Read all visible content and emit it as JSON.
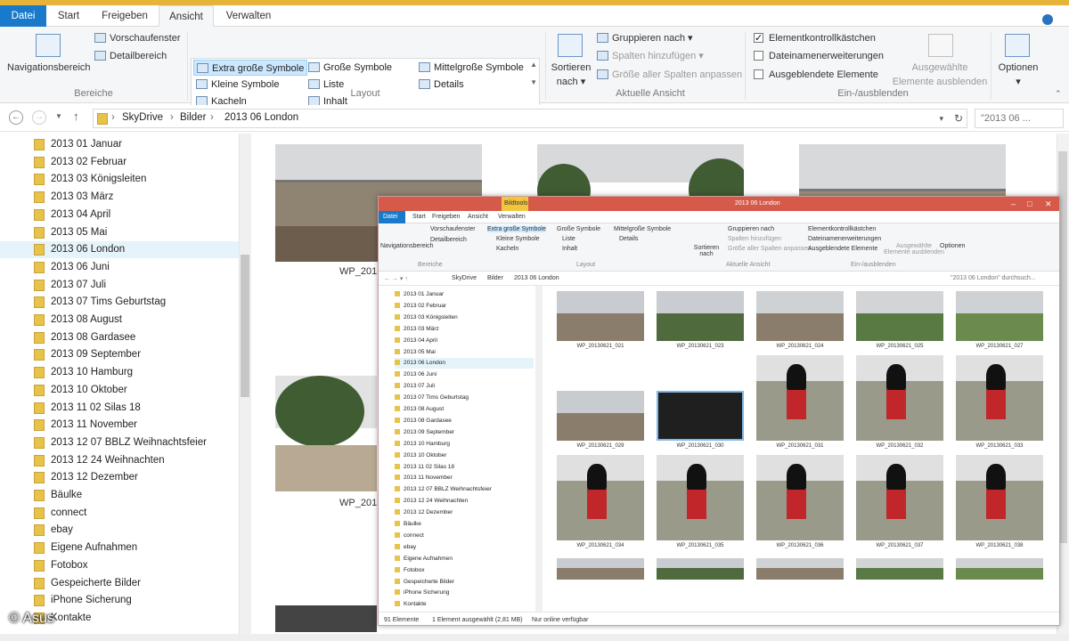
{
  "window": {
    "title": "2013 06  London"
  },
  "tabs": [
    "Datei",
    "Start",
    "Freigeben",
    "Ansicht",
    "Verwalten"
  ],
  "ribbon": {
    "bereiche": {
      "navigationsbereich": "Navigationsbereich",
      "vorschaufenster": "Vorschaufenster",
      "detailbereich": "Detailbereich",
      "label": "Bereiche"
    },
    "layout": {
      "items": [
        "Extra große Symbole",
        "Große Symbole",
        "Mittelgroße Symbole",
        "Kleine Symbole",
        "Liste",
        "Details",
        "Kacheln",
        "Inhalt"
      ],
      "label": "Layout"
    },
    "ansicht": {
      "sortieren": "Sortieren",
      "nach": "nach",
      "gruppieren": "Gruppieren nach",
      "spalten": "Spalten hinzufügen",
      "groesse": "Größe aller Spalten anpassen",
      "label": "Aktuelle Ansicht"
    },
    "einaus": {
      "kontroll": "Elementkontrollkästchen",
      "endungen": "Dateinamenerweiterungen",
      "ausgeblendet": "Ausgeblendete Elemente",
      "auswahl1": "Ausgewählte",
      "auswahl2": "Elemente ausblenden",
      "label": "Ein-/ausblenden"
    },
    "optionen": "Optionen"
  },
  "address": {
    "crumbs": [
      "SkyDrive",
      "Bilder",
      "2013 06  London"
    ],
    "search_placeholder": "\"2013 06 ..."
  },
  "nav_items": [
    "2013 01 Januar",
    "2013 02 Februar",
    "2013 03 Königsleiten",
    "2013 03 März",
    "2013 04 April",
    "2013 05 Mai",
    "2013 06  London",
    "2013 06 Juni",
    "2013 07 Juli",
    "2013 07 Tims Geburtstag",
    "2013 08 August",
    "2013 08 Gardasee",
    "2013 09 September",
    "2013 10 Hamburg",
    "2013 10 Oktober",
    "2013 11 02 Silas 18",
    "2013 11 November",
    "2013 12 07 BBLZ Weihnachtsfeier",
    "2013 12 24 Weihnachten",
    "2013 12 Dezember",
    "Bäulke",
    "connect",
    "ebay",
    "Eigene Aufnahmen",
    "Fotobox",
    "Gespeicherte Bilder",
    "iPhone Sicherung",
    "Kontakte"
  ],
  "content": {
    "captions": [
      "WP_2013",
      "WP_2013"
    ]
  },
  "inner": {
    "title": "2013 06  London",
    "context_tab": "Bildtools",
    "tabs": [
      "Datei",
      "Start",
      "Freigeben",
      "Ansicht",
      "Verwalten"
    ],
    "ribbon": [
      "Vorschaufenster",
      "Detailbereich",
      "Navigationsbereich",
      "Extra große Symbole",
      "Große Symbole",
      "Mittelgroße Symbole",
      "Kleine Symbole",
      "Liste",
      "Details",
      "Kacheln",
      "Inhalt",
      "Sortieren nach",
      "Gruppieren nach",
      "Spalten hinzufügen",
      "Größe aller Spalten anpassen",
      "Elementkontrollkästchen",
      "Dateinamenerweiterungen",
      "Ausgeblendete Elemente",
      "Ausgewählte Elemente ausblenden",
      "Optionen"
    ],
    "ribbon_groups": [
      "Bereiche",
      "Layout",
      "Aktuelle Ansicht",
      "Ein-/ausblenden"
    ],
    "address": [
      "SkyDrive",
      "Bilder",
      "2013 06  London"
    ],
    "search": "\"2013 06  London\" durchsuch...",
    "nav_items": [
      "2013 01 Januar",
      "2013 02 Februar",
      "2013 03 Königsleiten",
      "2013 03 März",
      "2013 04 April",
      "2013 05 Mai",
      "2013 06  London",
      "2013 06 Juni",
      "2013 07 Juli",
      "2013 07 Tims Geburtstag",
      "2013 08 August",
      "2013 08 Gardasee",
      "2013 09 September",
      "2013 10 Hamburg",
      "2013 10 Oktober",
      "2013 11 02 Silas 18",
      "2013 11 November",
      "2013 12 07 BBLZ Weihnachtsfeier",
      "2013 12 24 Weihnachten",
      "2013 12 Dezember",
      "Bäulke",
      "connect",
      "ebay",
      "Eigene Aufnahmen",
      "Fotobox",
      "Gespeicherte Bilder",
      "iPhone Sicherung",
      "Kontakte"
    ],
    "files": [
      "WP_20130621_021",
      "WP_20130621_023",
      "WP_20130621_024",
      "WP_20130621_025",
      "WP_20130621_027",
      "WP_20130621_029",
      "WP_20130621_030",
      "WP_20130621_031",
      "WP_20130621_032",
      "WP_20130621_033",
      "WP_20130621_034",
      "WP_20130621_035",
      "WP_20130621_036",
      "WP_20130621_037",
      "WP_20130621_038"
    ],
    "status": {
      "count": "91 Elemente",
      "selected": "1 Element ausgewählt (2,81 MB)",
      "online": "Nur online verfügbar"
    }
  },
  "watermark": "© Asus"
}
